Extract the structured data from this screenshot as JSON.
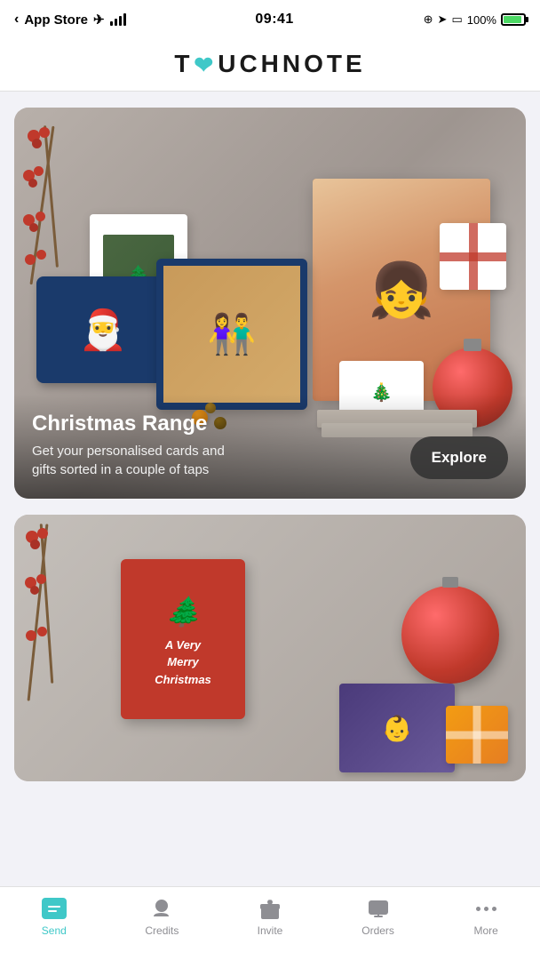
{
  "statusBar": {
    "carrier": "App Store",
    "time": "09:41",
    "battery": "100%"
  },
  "header": {
    "logo": "TOUCHNOTE",
    "logo_heart_char": "♥"
  },
  "heroCard": {
    "title": "Christmas Range",
    "subtitle": "Get your personalised cards and gifts sorted in a couple of taps",
    "exploreButton": "Explore"
  },
  "bottomNav": {
    "items": [
      {
        "id": "send",
        "label": "Send",
        "active": true
      },
      {
        "id": "credits",
        "label": "Credits",
        "active": false
      },
      {
        "id": "invite",
        "label": "Invite",
        "active": false
      },
      {
        "id": "orders",
        "label": "Orders",
        "active": false
      },
      {
        "id": "more",
        "label": "More",
        "active": false
      }
    ]
  },
  "colors": {
    "teal": "#3fc8c8",
    "inactive": "#8e8e93"
  }
}
